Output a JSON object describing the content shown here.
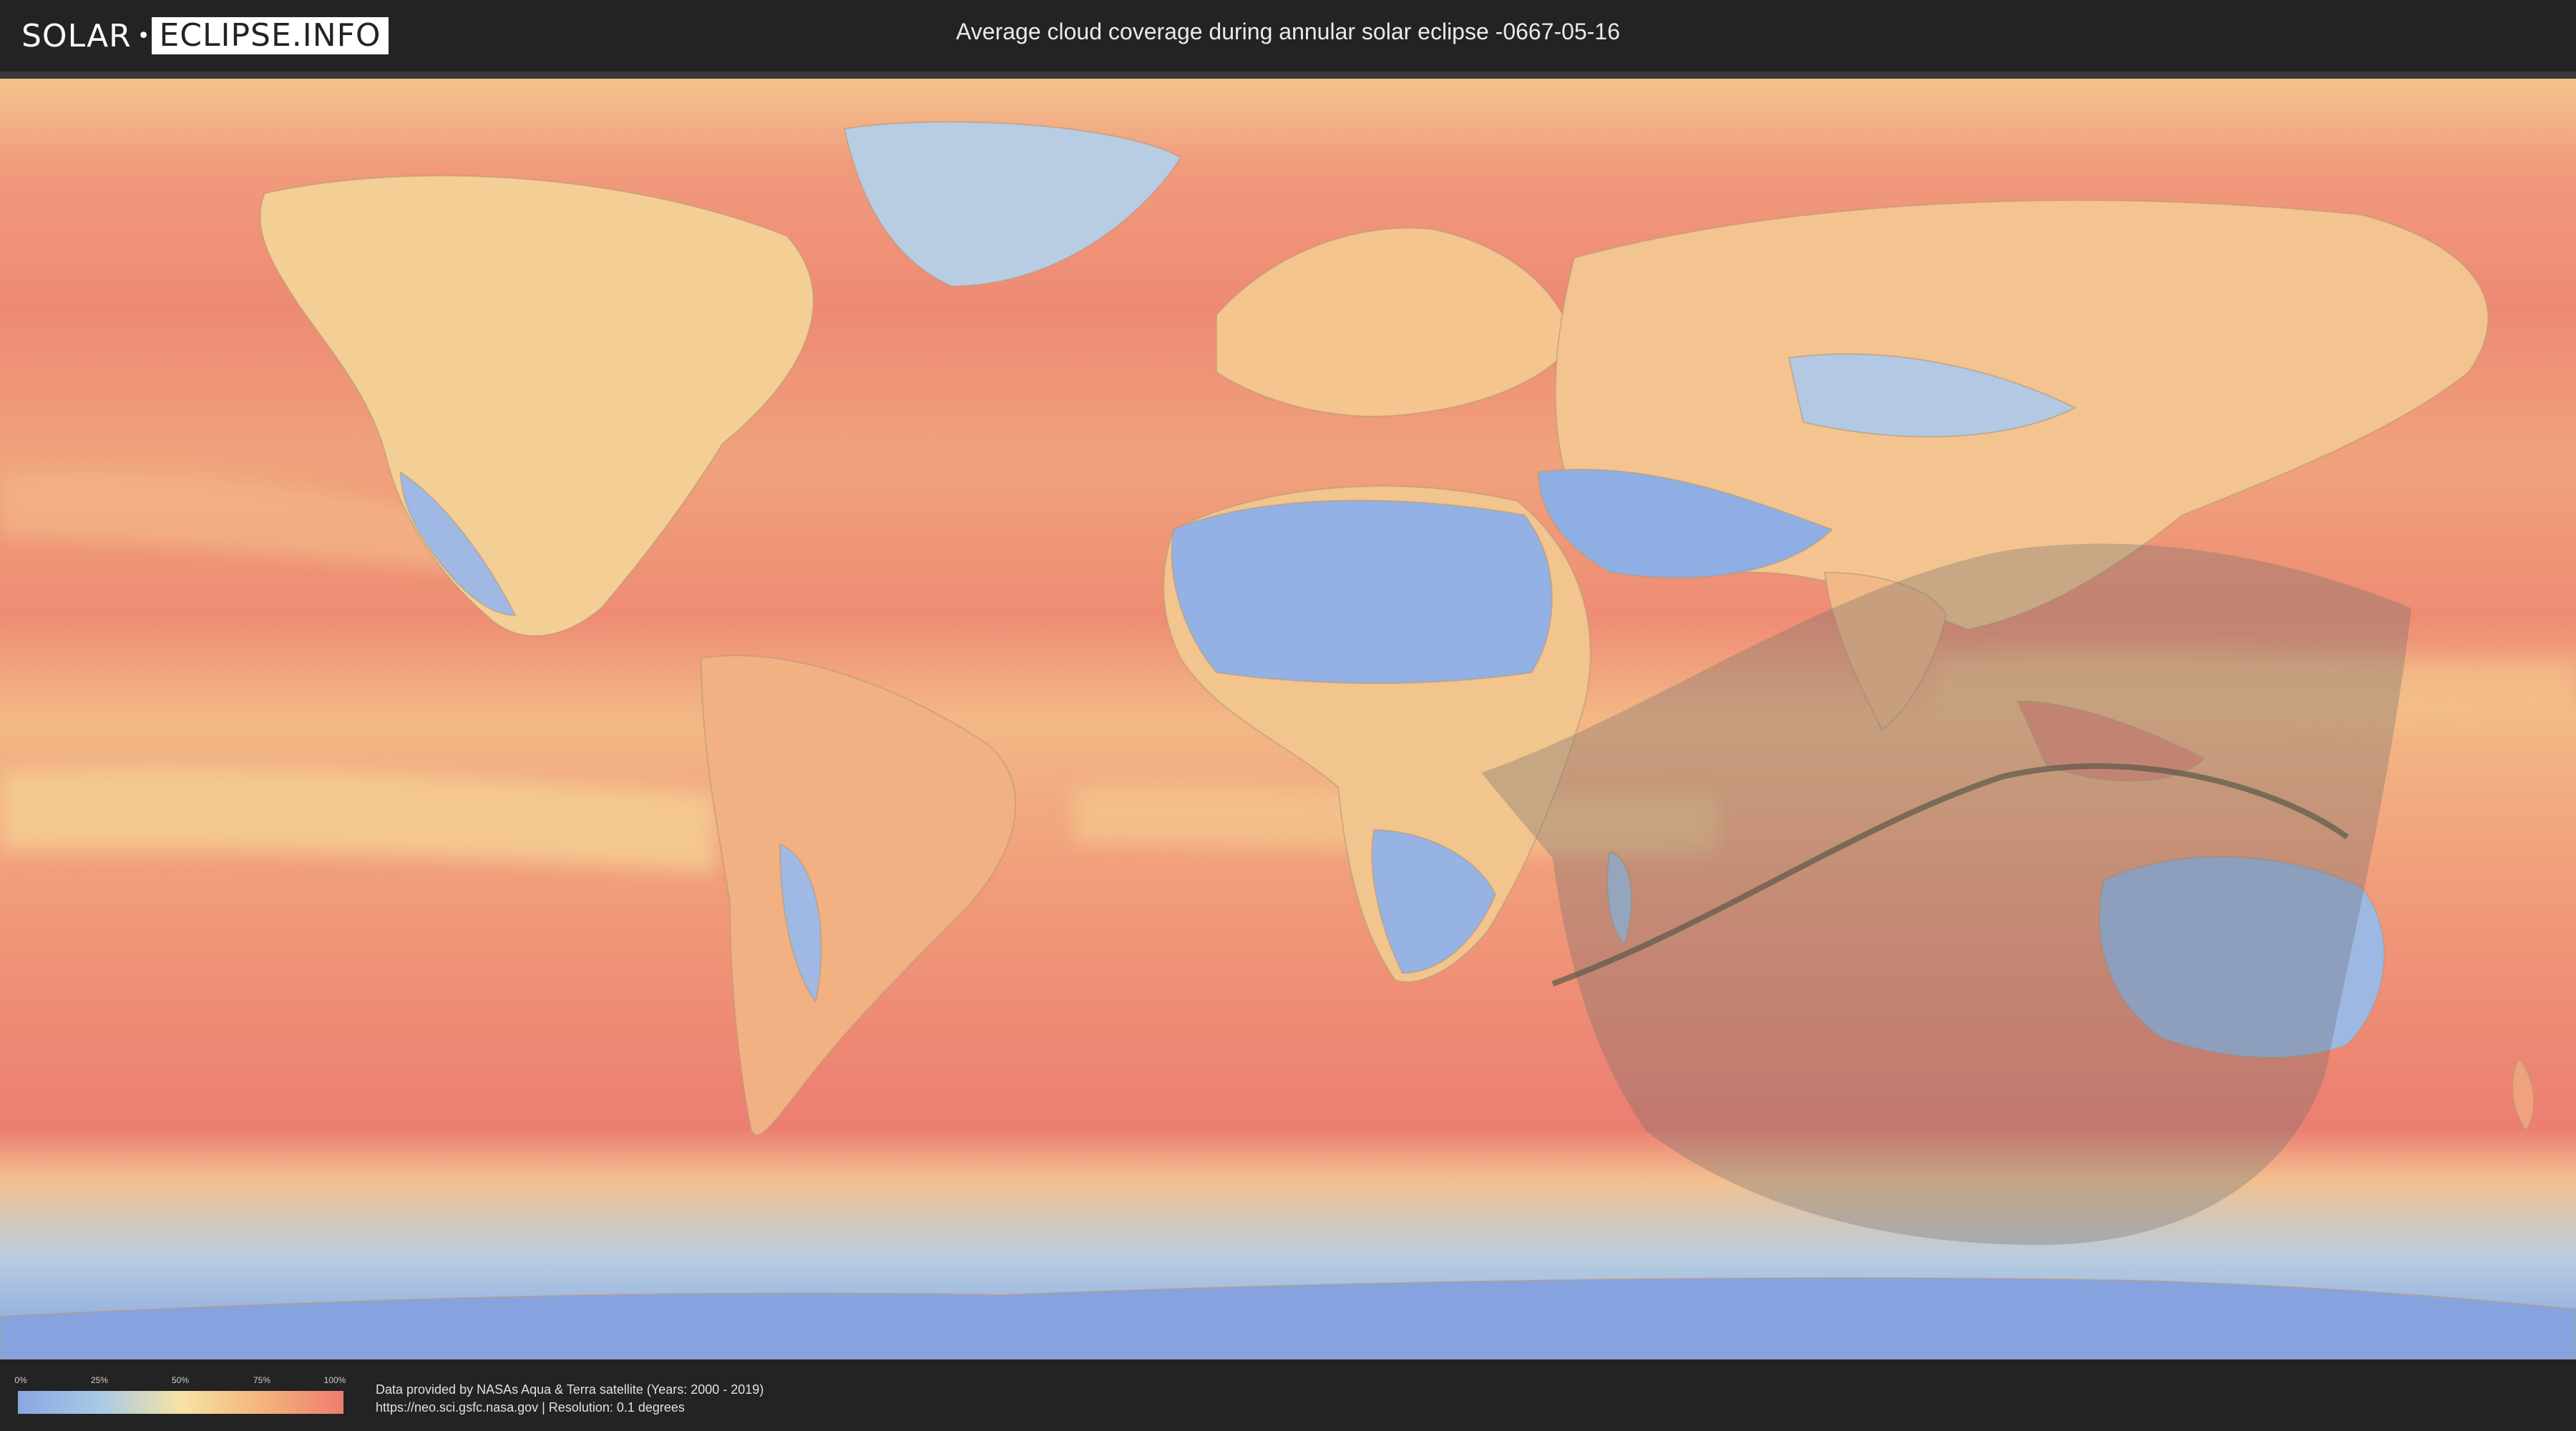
{
  "header": {
    "logo_left": "SOLAR",
    "logo_right": "ECLIPSE.INFO",
    "title": "Average cloud coverage during annular solar eclipse -0667-05-16"
  },
  "legend": {
    "ticks": [
      "0%",
      "25%",
      "50%",
      "75%",
      "100%"
    ],
    "colors": [
      "#8aa6e0",
      "#a9c9e6",
      "#f6e3a5",
      "#f4b47a",
      "#ee7d72"
    ]
  },
  "footer": {
    "credit_line1": "Data provided by NASAs Aqua & Terra satellite (Years: 2000 - 2019)",
    "credit_line2": "https://neo.sci.gsfc.nasa.gov | Resolution: 0.1 degrees"
  },
  "map": {
    "projection": "equirectangular",
    "ocean_color": "#ef9a78",
    "high_cloud_color": "#eb7f72",
    "clear_sky_color": "#8aa6e0",
    "eclipse_shadow_color": "#6e6e6e",
    "central_line_color": "#5a5a4a"
  }
}
